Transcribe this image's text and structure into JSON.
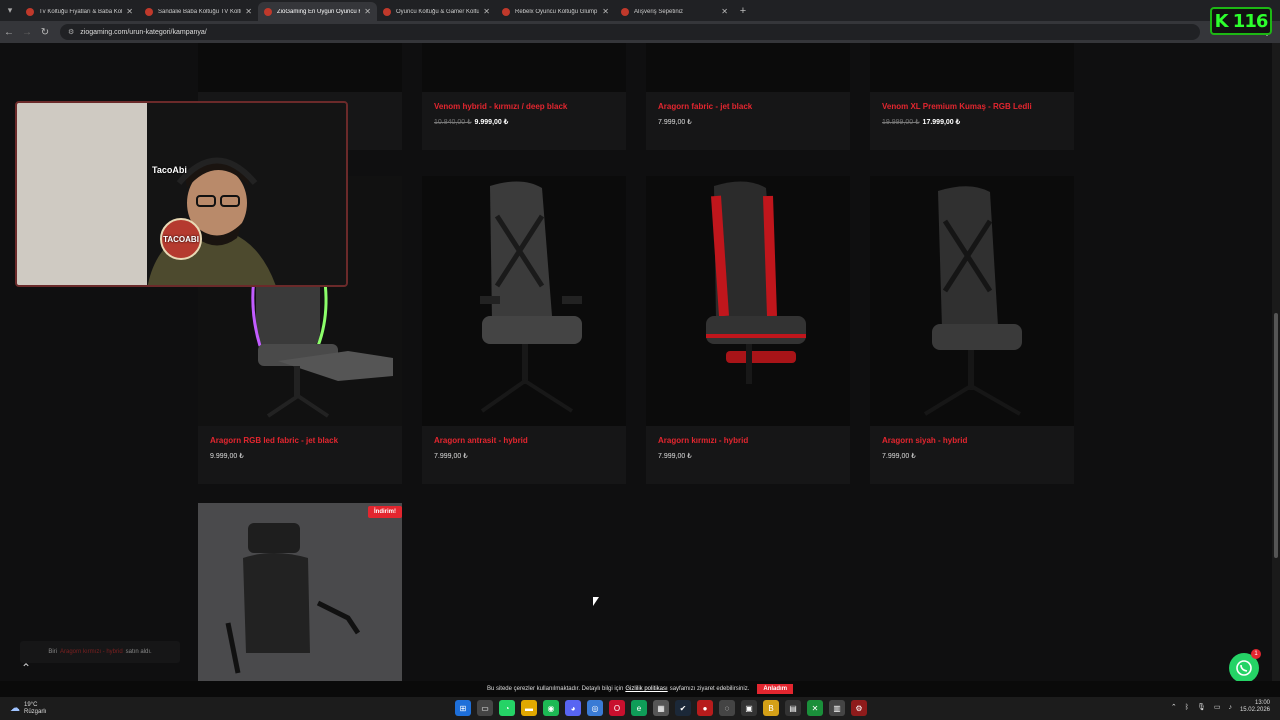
{
  "browser": {
    "tabs": [
      {
        "title": "Tv Koltuğu Fiyatları & Baba Kolt",
        "active": false
      },
      {
        "title": "Sandalie Baba Koltuğu TV Koltu",
        "active": false
      },
      {
        "title": "ZioGaming En Uygun Oyuncu K",
        "active": true
      },
      {
        "title": "Oyuncu Koltuğu & Gamer Koltu",
        "active": false
      },
      {
        "title": "Rebelx Oyuncu Koltuğu Glump",
        "active": false
      },
      {
        "title": "Alışveriş Sepetiniz",
        "active": false
      }
    ],
    "url": "ziogaming.com/urun-kategori/kampanya/"
  },
  "products_top": [
    {
      "name": "",
      "old_price": "",
      "price": ""
    },
    {
      "name": "Venom hybrid - kırmızı / deep black",
      "old_price": "10.840,00 ₺",
      "price": "9.999,00 ₺"
    },
    {
      "name": "Aragorn fabric - jet black",
      "old_price": "",
      "price": "7.999,00 ₺"
    },
    {
      "name": "Venom XL Premium Kumaş - RGB Ledli",
      "old_price": "19.999,00 ₺",
      "price": "17.999,00 ₺"
    }
  ],
  "products_middle": [
    {
      "name": "Aragorn RGB led fabric - jet black",
      "old_price": "",
      "price": "9.999,00 ₺"
    },
    {
      "name": "Aragorn antrasit - hybrid",
      "old_price": "",
      "price": "7.999,00 ₺"
    },
    {
      "name": "Aragorn kırmızı - hybrid",
      "old_price": "",
      "price": "7.999,00 ₺"
    },
    {
      "name": "Aragorn siyah - hybrid",
      "old_price": "",
      "price": "7.999,00 ₺"
    }
  ],
  "product_bottom": {
    "badge": "İndirim!"
  },
  "webcam": {
    "streamer_name": "TacoAbi",
    "badge": "TACOABI"
  },
  "sale_toast": {
    "prefix": "Biri",
    "product": "Aragorn kırmızı - hybrid",
    "suffix": "satın aldı."
  },
  "cookie": {
    "text_before": "Bu sitede çerezler kullanılmaktadır. Detaylı bilgi için",
    "link": "Gizlilik politikası",
    "text_after": "sayfamızı ziyaret edebilirsiniz.",
    "accept": "Anladım"
  },
  "whatsapp": {
    "count": "1"
  },
  "overlay_logo": {
    "text": "K 116"
  },
  "taskbar": {
    "weather_temp": "19°C",
    "weather_desc": "Rüzgarlı",
    "time": "13:00",
    "date": "15.02.2026"
  },
  "colors": {
    "accent": "#e3262f",
    "whatsapp": "#25d366",
    "logo_green": "#2dff2d"
  }
}
